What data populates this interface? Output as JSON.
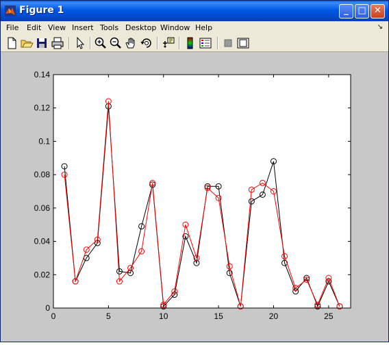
{
  "window": {
    "title": "Figure 1"
  },
  "menu": [
    "File",
    "Edit",
    "View",
    "Insert",
    "Tools",
    "Desktop",
    "Window",
    "Help"
  ],
  "toolbar_icons": [
    "new-file-icon",
    "open-folder-icon",
    "save-icon",
    "print-icon",
    "pointer-arrow-icon",
    "zoom-in-icon",
    "zoom-out-icon",
    "pan-hand-icon",
    "rotate-3d-icon",
    "data-cursor-icon",
    "colorbar-icon",
    "legend-icon",
    "hide-plot-tools-icon",
    "show-plot-tools-icon"
  ],
  "chart_data": {
    "type": "line",
    "title": "",
    "xlabel": "",
    "ylabel": "",
    "xlim": [
      0,
      27
    ],
    "ylim": [
      0,
      0.14
    ],
    "x_ticks": [
      "0",
      "5",
      "10",
      "15",
      "20",
      "25"
    ],
    "y_ticks": [
      "0",
      "0.02",
      "0.04",
      "0.06",
      "0.08",
      "0.1",
      "0.12",
      "0.14"
    ],
    "grid": false,
    "x": [
      1,
      2,
      3,
      4,
      5,
      6,
      7,
      8,
      9,
      10,
      11,
      12,
      13,
      14,
      15,
      16,
      17,
      18,
      19,
      20,
      21,
      22,
      23,
      24,
      25,
      26
    ],
    "series": [
      {
        "color": "#000000",
        "marker": "circle",
        "values": [
          0.085,
          0.016,
          0.03,
          0.039,
          0.121,
          0.022,
          0.021,
          0.049,
          0.074,
          0.001,
          0.008,
          0.043,
          0.027,
          0.073,
          0.073,
          0.021,
          0.001,
          0.064,
          0.068,
          0.088,
          0.027,
          0.01,
          0.018,
          0.001,
          0.016,
          0.001
        ]
      },
      {
        "color": "#ff0000",
        "marker": "circle",
        "values": [
          0.08,
          0.016,
          0.035,
          0.041,
          0.124,
          0.016,
          0.024,
          0.034,
          0.075,
          0.002,
          0.01,
          0.05,
          0.03,
          0.072,
          0.066,
          0.025,
          0.001,
          0.071,
          0.075,
          0.07,
          0.031,
          0.012,
          0.017,
          0.002,
          0.018,
          0.001
        ]
      }
    ]
  }
}
